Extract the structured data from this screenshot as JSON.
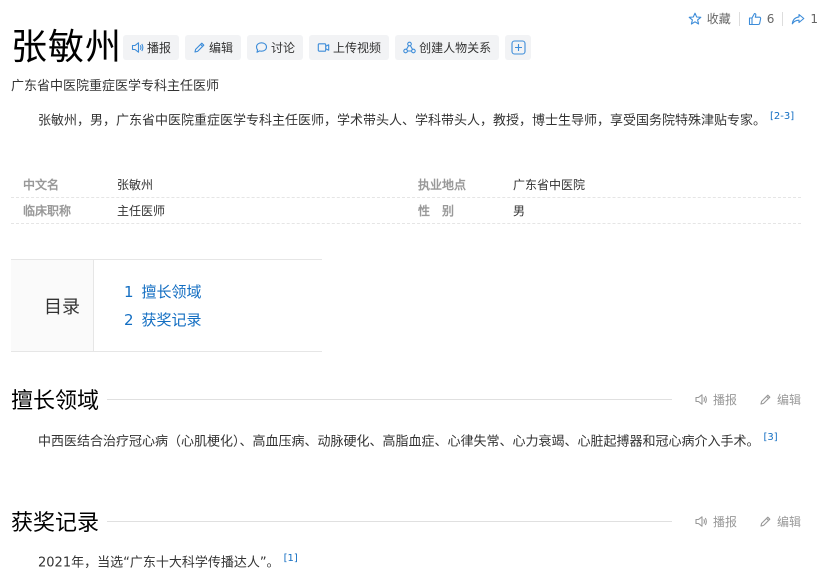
{
  "top_actions": {
    "favorite_label": "收藏",
    "like_count": "6",
    "share_count": "1"
  },
  "title": "张敏州",
  "toolbar": {
    "broadcast": "播报",
    "edit": "编辑",
    "discuss": "讨论",
    "upload_video": "上传视频",
    "create_relation": "创建人物关系"
  },
  "subtitle": "广东省中医院重症医学专科主任医师",
  "summary": {
    "text": "张敏州，男，广东省中医院重症医学专科主任医师，学术带头人、学科带头人，教授，博士生导师，享受国务院特殊津贴专家。",
    "ref": "[2-3]"
  },
  "infobox": {
    "rows": [
      {
        "k1": "中文名",
        "v1": "张敏州",
        "k2": "执业地点",
        "v2": "广东省中医院"
      },
      {
        "k1": "临床职称",
        "v1": "主任医师",
        "k2": "性　别",
        "v2": "男"
      }
    ]
  },
  "toc": {
    "title": "目录",
    "items": [
      {
        "num": "1",
        "label": "擅长领域"
      },
      {
        "num": "2",
        "label": "获奖记录"
      }
    ]
  },
  "sections": [
    {
      "heading": "擅长领域",
      "broadcast": "播报",
      "edit": "编辑",
      "text": "中西医结合治疗冠心病（心肌梗化）、高血压病、动脉硬化、高脂血症、心律失常、心力衰竭、心脏起搏器和冠心病介入手术。",
      "ref": "[3]"
    },
    {
      "heading": "获奖记录",
      "broadcast": "播报",
      "edit": "编辑",
      "text": "2021年，当选“广东十大科学传播达人”。",
      "ref": "[1]"
    }
  ],
  "colors": {
    "link": "#136ec2",
    "toolbar_bg": "#f2f3f5",
    "icon_blue": "#3c8cd9"
  },
  "icons": [
    "star-icon",
    "thumb-up-icon",
    "share-icon",
    "speaker-icon",
    "pencil-icon",
    "chat-icon",
    "video-icon",
    "relation-icon",
    "plus-icon"
  ]
}
